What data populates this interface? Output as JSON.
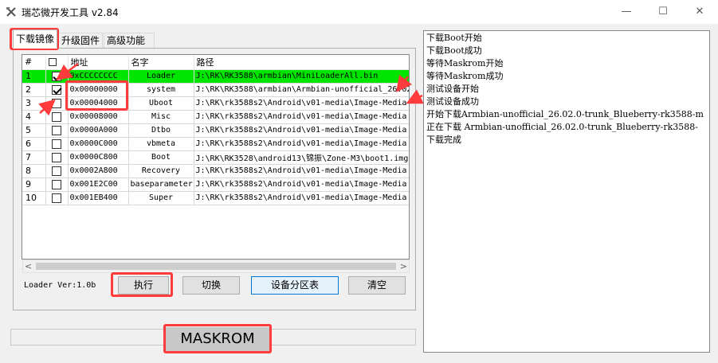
{
  "window": {
    "title": "瑞芯微开发工具 v2.84",
    "minimize_glyph": "—",
    "maximize_glyph": "☐",
    "close_glyph": "✕"
  },
  "tabs": [
    {
      "label": "下载镜像",
      "active": true
    },
    {
      "label": "升级固件",
      "active": false
    },
    {
      "label": "高级功能",
      "active": false
    }
  ],
  "grid": {
    "columns": [
      "#",
      "",
      "地址",
      "名字",
      "路径"
    ],
    "rows": [
      {
        "num": "1",
        "checked": true,
        "address": "0xCCCCCCCC",
        "name": "Loader",
        "path": "J:\\RK\\RK3588\\armbian\\MiniLoaderAll.bin",
        "selected": true
      },
      {
        "num": "2",
        "checked": true,
        "address": "0x00000000",
        "name": "system",
        "path": "J:\\RK\\RK3588\\armbian\\Armbian-unofficial_26.02.0",
        "selected": false
      },
      {
        "num": "3",
        "checked": false,
        "address": "0x00004000",
        "name": "Uboot",
        "path": "J:\\RK\\rk3588s2\\Android\\v01-media\\Image-Media",
        "selected": false
      },
      {
        "num": "4",
        "checked": false,
        "address": "0x00008000",
        "name": "Misc",
        "path": "J:\\RK\\rk3588s2\\Android\\v01-media\\Image-Media",
        "selected": false
      },
      {
        "num": "5",
        "checked": false,
        "address": "0x0000A000",
        "name": "Dtbo",
        "path": "J:\\RK\\rk3588s2\\Android\\v01-media\\Image-Media",
        "selected": false
      },
      {
        "num": "6",
        "checked": false,
        "address": "0x0000C000",
        "name": "vbmeta",
        "path": "J:\\RK\\rk3588s2\\Android\\v01-media\\Image-Media",
        "selected": false
      },
      {
        "num": "7",
        "checked": false,
        "address": "0x0000C800",
        "name": "Boot",
        "path": "J:\\RK\\RK3528\\android13\\锦振\\Zone-M3\\boot1.img",
        "selected": false
      },
      {
        "num": "8",
        "checked": false,
        "address": "0x0002A800",
        "name": "Recovery",
        "path": "J:\\RK\\rk3588s2\\Android\\v01-media\\Image-Media",
        "selected": false
      },
      {
        "num": "9",
        "checked": false,
        "address": "0x001E2C00",
        "name": "baseparameter",
        "path": "J:\\RK\\rk3588s2\\Android\\v01-media\\Image-Media",
        "selected": false
      },
      {
        "num": "10",
        "checked": false,
        "address": "0x001EB400",
        "name": "Super",
        "path": "J:\\RK\\rk3588s2\\Android\\v01-media\\Image-Media",
        "selected": false
      }
    ]
  },
  "scrollbar": {
    "left_arrow": "<",
    "right_arrow": ">"
  },
  "loader_version": "Loader Ver:1.0b",
  "buttons": {
    "execute": "执行",
    "switch": "切换",
    "partition_table": "设备分区表",
    "clear": "清空"
  },
  "status": {
    "mode": "MASKROM"
  },
  "log": [
    "下载Boot开始",
    "下载Boot成功",
    "等待Maskrom开始",
    "等待Maskrom成功",
    "测试设备开始",
    "测试设备成功",
    "开始下载Armbian-unofficial_26.02.0-trunk_Blueberry-rk3588-m",
    "正在下载 Armbian-unofficial_26.02.0-trunk_Blueberry-rk3588-",
    "下载完成"
  ],
  "colors": {
    "highlight": "#ff3b3b",
    "selected_row": "#00e500"
  }
}
